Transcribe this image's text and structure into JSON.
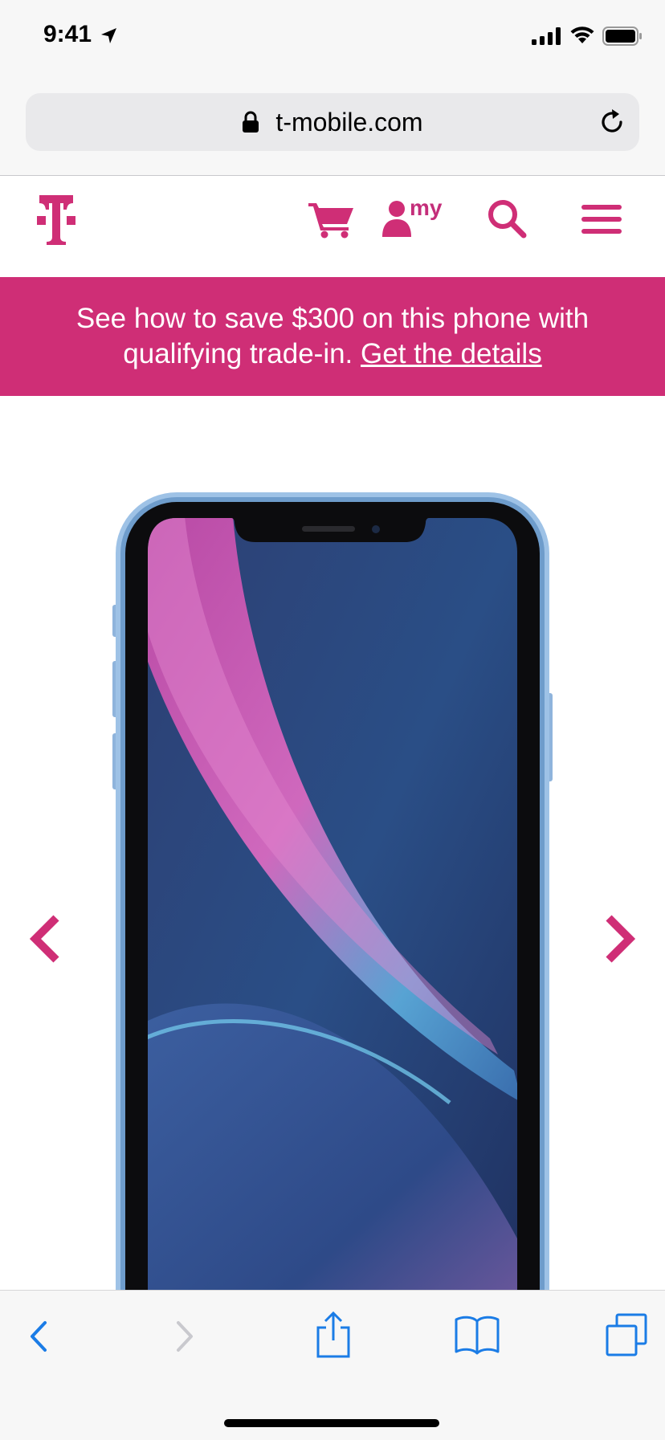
{
  "status_bar": {
    "time": "9:41"
  },
  "browser": {
    "url": "t-mobile.com"
  },
  "header": {
    "logo": "T",
    "icons": [
      "cart-icon",
      "person-icon",
      "search-icon",
      "menu-icon"
    ],
    "account_label": "my"
  },
  "promo": {
    "text": "See how to save $300 on this phone with qualifying trade-in.",
    "link": "Get the details",
    "background": "#cf2e76"
  },
  "gallery": {
    "image": "iPhone XR blue",
    "prev_icon": "chevron-left-icon",
    "next_icon": "chevron-right-icon"
  },
  "toolbar": {
    "items": [
      "back-icon",
      "forward-icon",
      "share-icon",
      "bookmarks-icon",
      "tabs-icon"
    ]
  },
  "colors": {
    "brand": "#cf2e76",
    "ios_blue": "#1b7ce6"
  }
}
